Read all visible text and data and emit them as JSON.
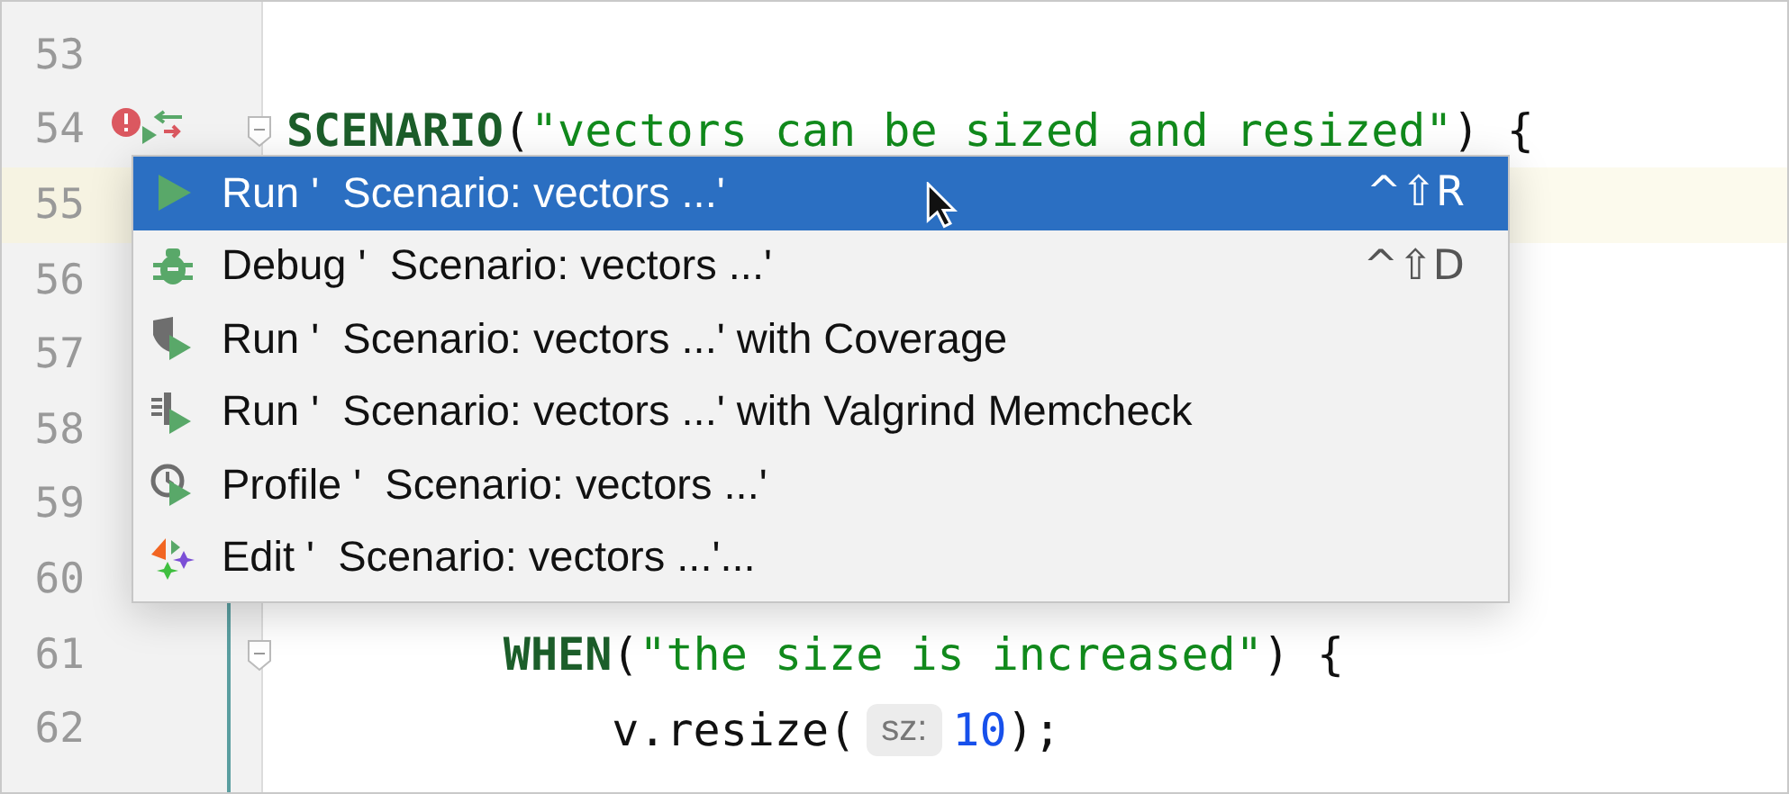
{
  "editor": {
    "lines": [
      {
        "number": "53",
        "highlighted": false
      },
      {
        "number": "54",
        "highlighted": false,
        "error_marker": true,
        "run_marker": true,
        "foldable": true,
        "tokens": [
          {
            "kind": "keyword",
            "text": "SCENARIO"
          },
          {
            "kind": "plain",
            "text": "("
          },
          {
            "kind": "string",
            "text": "\"vectors can be sized and resized\""
          },
          {
            "kind": "plain",
            "text": ") {"
          }
        ]
      },
      {
        "number": "55",
        "highlighted": true
      },
      {
        "number": "56",
        "highlighted": false
      },
      {
        "number": "57",
        "highlighted": false
      },
      {
        "number": "58",
        "highlighted": false
      },
      {
        "number": "59",
        "highlighted": false
      },
      {
        "number": "60",
        "highlighted": false
      },
      {
        "number": "61",
        "highlighted": false,
        "foldable": true,
        "tokens": [
          {
            "kind": "keyword",
            "text": "        WHEN"
          },
          {
            "kind": "plain",
            "text": "("
          },
          {
            "kind": "string",
            "text": "\"the size is increased\""
          },
          {
            "kind": "plain",
            "text": ") {"
          }
        ]
      },
      {
        "number": "62",
        "highlighted": false,
        "tokens": [
          {
            "kind": "plain",
            "text": "            v.resize("
          },
          {
            "kind": "hint",
            "text": "sz:"
          },
          {
            "kind": "number",
            "text": "10"
          },
          {
            "kind": "plain",
            "text": ");"
          }
        ]
      }
    ]
  },
  "popup_menu": {
    "items": [
      {
        "label": "Run '  Scenario: vectors ...'",
        "shortcut": "^⇧R",
        "selected": true
      },
      {
        "label": "Debug '  Scenario: vectors ...'",
        "shortcut": "^⇧D",
        "selected": false
      },
      {
        "label": "Run '  Scenario: vectors ...' with Coverage",
        "selected": false
      },
      {
        "label": "Run '  Scenario: vectors ...' with Valgrind Memcheck",
        "selected": false
      },
      {
        "label": "Profile '  Scenario: vectors ...'",
        "selected": false
      },
      {
        "label": "Edit '  Scenario: vectors ...'...",
        "selected": false
      }
    ]
  }
}
